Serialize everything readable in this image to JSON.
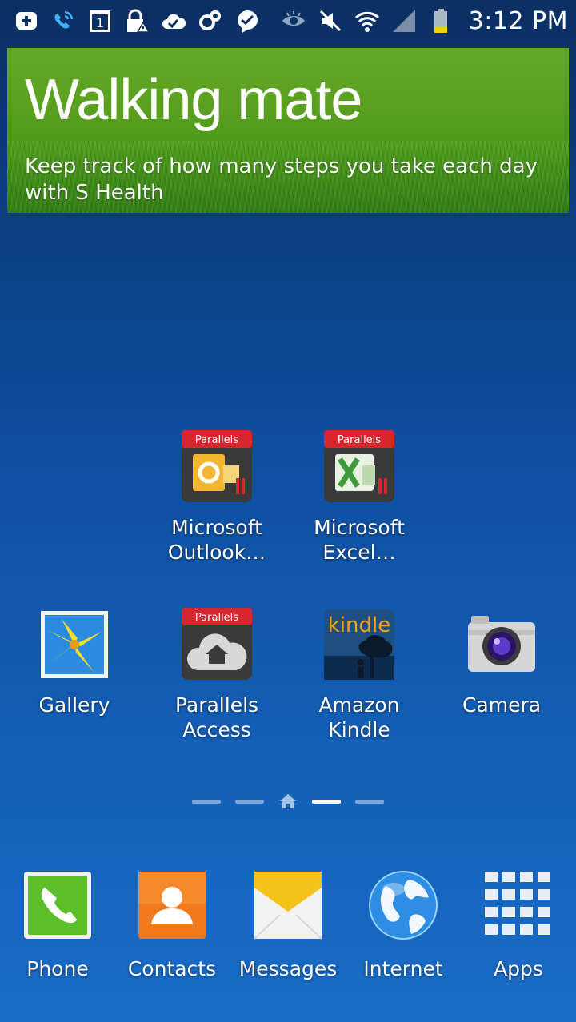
{
  "status_bar": {
    "time": "3:12 PM",
    "left_icons": [
      "add-icon",
      "wifi-calling-icon",
      "calendar-icon",
      "lock-warning-icon",
      "cloud-check-icon",
      "sync-icon",
      "messenger-icon"
    ],
    "right_icons": [
      "eye-icon",
      "mute-icon",
      "wifi-icon",
      "signal-icon",
      "battery-icon"
    ],
    "calendar_day": "1"
  },
  "banner": {
    "title": "Walking mate",
    "subtitle": "Keep track of how many steps you take each day with S Health"
  },
  "apps": [
    {
      "id": "outlook",
      "label": "Microsoft\nOutlook…",
      "badge": "Parallels",
      "icon": "outlook-icon"
    },
    {
      "id": "excel",
      "label": "Microsoft\nExcel…",
      "badge": "Parallels",
      "icon": "excel-icon"
    },
    {
      "id": "gallery",
      "label": "Gallery",
      "icon": "gallery-icon"
    },
    {
      "id": "parallels-access",
      "label": "Parallels\nAccess",
      "badge": "Parallels",
      "icon": "parallels-access-icon"
    },
    {
      "id": "kindle",
      "label": "Amazon\nKindle",
      "badge": "kindle",
      "icon": "kindle-icon"
    },
    {
      "id": "camera",
      "label": "Camera",
      "icon": "camera-icon"
    }
  ],
  "page_indicator": {
    "pages": 5,
    "home_index": 2,
    "active_index": 3
  },
  "dock": [
    {
      "id": "phone",
      "label": "Phone",
      "icon": "phone-icon"
    },
    {
      "id": "contacts",
      "label": "Contacts",
      "icon": "contacts-icon"
    },
    {
      "id": "messages",
      "label": "Messages",
      "icon": "messages-icon"
    },
    {
      "id": "internet",
      "label": "Internet",
      "icon": "globe-icon"
    },
    {
      "id": "apps",
      "label": "Apps",
      "icon": "apps-grid-icon"
    }
  ],
  "colors": {
    "parallels_red": "#d9262e",
    "phone_green": "#5cbf2a",
    "contacts_orange": "#f07a1c",
    "messages_yellow": "#f5c21b"
  }
}
